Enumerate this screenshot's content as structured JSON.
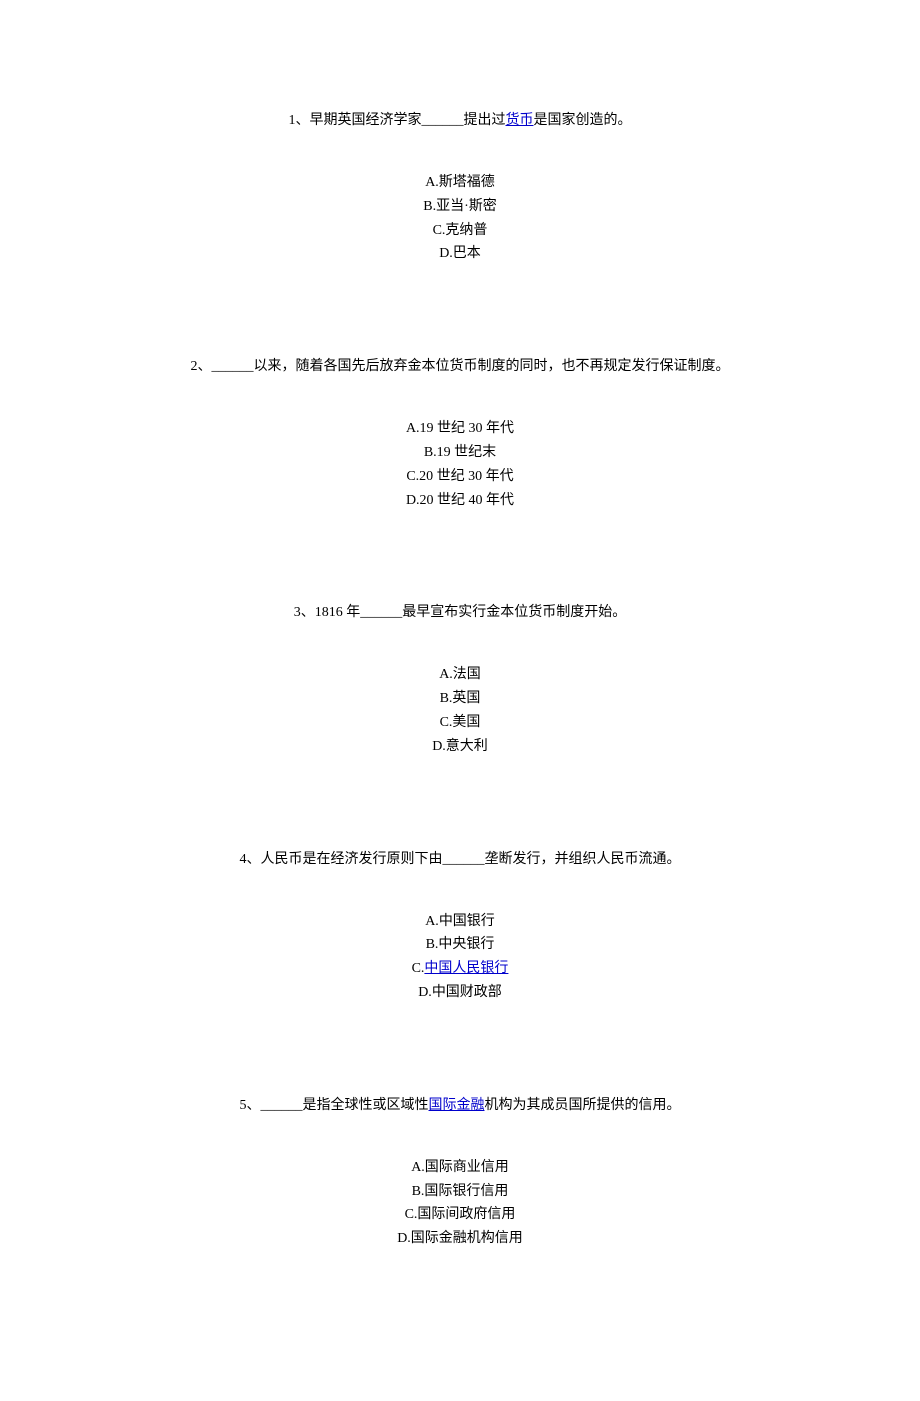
{
  "questions": [
    {
      "number": "1、",
      "pre": "早期英国经济学家",
      "blank": "______",
      "mid": "提出过",
      "link": "货币",
      "post": "是国家创造的。",
      "options": [
        "A.斯塔福德",
        "B.亚当·斯密",
        "C.克纳普",
        "D.巴本"
      ]
    },
    {
      "number": "2、",
      "pre": "",
      "blank": "______",
      "mid": "以来，随着各国先后放弃金本位货币制度的同时，也不再规定发行保证制度。",
      "link": "",
      "post": "",
      "options": [
        "A.19 世纪 30 年代",
        "B.19 世纪末",
        "C.20 世纪 30 年代",
        "D.20 世纪 40 年代"
      ]
    },
    {
      "number": "3、",
      "pre": "1816 年",
      "blank": "______",
      "mid": "最早宣布实行金本位货币制度开始。",
      "link": "",
      "post": "",
      "options": [
        "A.法国",
        "B.英国",
        "C.美国",
        "D.意大利"
      ]
    },
    {
      "number": "4、",
      "pre": "人民币是在经济发行原则下由",
      "blank": "______",
      "mid": "垄断发行，并组织人民币流通。",
      "link": "",
      "post": "",
      "options_special": [
        {
          "label": "A.",
          "text": "中国银行",
          "link": false
        },
        {
          "label": "B.",
          "text": "中央银行",
          "link": false
        },
        {
          "label": "C.",
          "text": "中国人民银行",
          "link": true
        },
        {
          "label": "D.",
          "text": "中国财政部",
          "link": false
        }
      ]
    },
    {
      "number": "5、",
      "pre": "",
      "blank": "______",
      "mid": "是指全球性或区域性",
      "link": "国际金融",
      "post": "机构为其成员国所提供的信用。",
      "options": [
        "A.国际商业信用",
        "B.国际银行信用",
        "C.国际间政府信用",
        "D.国际金融机构信用"
      ]
    }
  ]
}
